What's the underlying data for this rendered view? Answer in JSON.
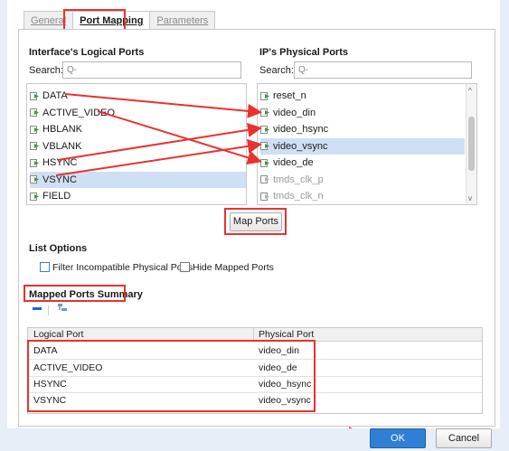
{
  "tabs": [
    {
      "label": "General"
    },
    {
      "label": "Port Mapping"
    },
    {
      "label": "Parameters"
    }
  ],
  "logical": {
    "heading": "Interface's Logical Ports",
    "search_label": "Search:",
    "search_placeholder": "Q-",
    "items": [
      "DATA",
      "ACTIVE_VIDEO",
      "HBLANK",
      "VBLANK",
      "HSYNC",
      "VSYNC",
      "FIELD"
    ],
    "selected": "VSYNC"
  },
  "physical": {
    "heading": "IP's Physical Ports",
    "search_label": "Search:",
    "search_placeholder": "Q-",
    "items": [
      "reset_n",
      "video_din",
      "video_hsync",
      "video_vsync",
      "video_de",
      "tmds_clk_p",
      "tmds_clk_n"
    ],
    "selected": "video_vsync"
  },
  "map_ports_button": "Map Ports",
  "list_options": {
    "heading": "List Options",
    "filter_label": "Filter Incompatible Physical Ports",
    "hide_label": "Hide Mapped Ports"
  },
  "summary": {
    "heading": "Mapped Ports Summary",
    "columns": [
      "Logical Port",
      "Physical Port"
    ],
    "rows": [
      [
        "DATA",
        "video_din"
      ],
      [
        "ACTIVE_VIDEO",
        "video_de"
      ],
      [
        "HSYNC",
        "video_hsync"
      ],
      [
        "VSYNC",
        "video_vsync"
      ]
    ]
  },
  "footer": {
    "ok": "OK",
    "cancel": "Cancel"
  },
  "colors": {
    "highlight_red": "#e8322f",
    "selection": "#cfe0f5",
    "ok_blue": "#2f7fd6",
    "port_green": "#3f9b3f"
  }
}
